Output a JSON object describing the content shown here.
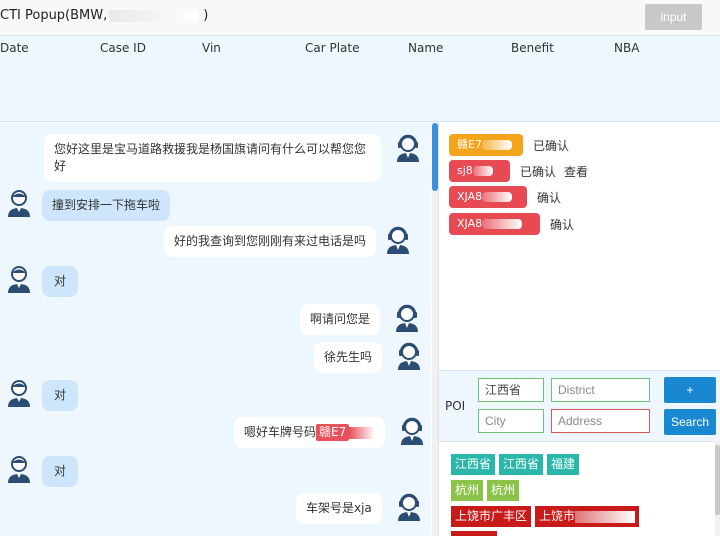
{
  "header": {
    "title_prefix": "CTI Popup(BMW,",
    "title_suffix": ")",
    "input_button": "input"
  },
  "table": {
    "columns": [
      "Date",
      "Case ID",
      "Vin",
      "Car Plate",
      "Name",
      "Benefit",
      "NBA"
    ]
  },
  "chat": {
    "messages": [
      {
        "from": "agent",
        "text": "您好这里是宝马道路救援我是杨国旗请问有什么可以帮您您好"
      },
      {
        "from": "customer",
        "text": "撞到安排一下拖车啦"
      },
      {
        "from": "agent",
        "text": "好的我查询到您刚刚有来过电话是吗"
      },
      {
        "from": "customer",
        "text": "对"
      },
      {
        "from": "agent",
        "text": "啊请问您是"
      },
      {
        "from": "agent",
        "text": "徐先生吗"
      },
      {
        "from": "customer",
        "text": "对"
      },
      {
        "from": "agent",
        "text": "嗯好车牌号码",
        "plate": "赣E7"
      },
      {
        "from": "customer",
        "text": "对"
      },
      {
        "from": "agent",
        "text": "车架号是xja"
      }
    ]
  },
  "cars": [
    {
      "plate": "赣E7",
      "color": "#f4a41a",
      "status": "已确认",
      "link": ""
    },
    {
      "plate": "sj8",
      "color": "#e84a54",
      "status": "已确认",
      "link": "查看"
    },
    {
      "plate": "XJA8",
      "color": "#e84a54",
      "status": "确认",
      "link": ""
    },
    {
      "plate": "XJA8",
      "color": "#e84a54",
      "status": "确认",
      "link": ""
    }
  ],
  "poi": {
    "label": "POI",
    "province_value": "江西省",
    "district_placeholder": "District",
    "city_placeholder": "City",
    "address_placeholder": "Address",
    "add_button": "+",
    "search_button": "Search"
  },
  "tags": {
    "row1": [
      "江西省",
      "江西省",
      "福建"
    ],
    "row2": [
      "杭州",
      "杭州"
    ],
    "row3": [
      "上饶市广丰区",
      "上饶市"
    ]
  },
  "colors": {
    "accent": "#1a88d0",
    "customer_bubble": "#cde6fb",
    "pane_background": "#eef7fd"
  }
}
